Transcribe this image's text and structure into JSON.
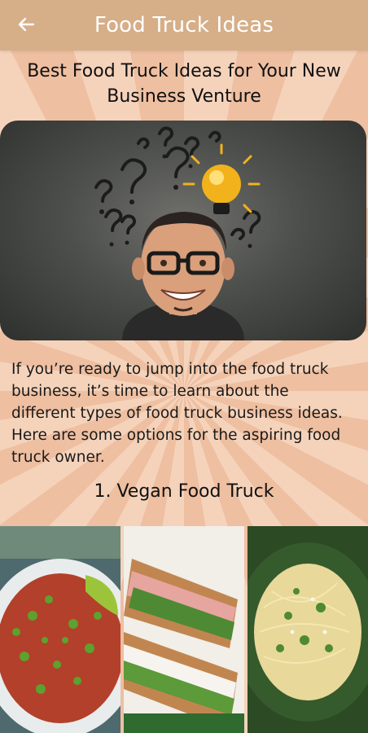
{
  "app_bar": {
    "title": "Food Truck Ideas",
    "back_icon": "arrow-left-icon",
    "color": "#d6ae87"
  },
  "article": {
    "headline": "Best Food Truck Ideas for Your New Business Venture",
    "hero_image": "man-thinking-with-question-marks-and-lightbulb",
    "intro": "If you’re ready to jump into the food truck business, it’s time to learn about the different types of food truck business ideas. Here are some options for the aspiring food truck owner.",
    "section_1_title": "1. Vegan Food Truck"
  },
  "photos": [
    {
      "name": "vegan-salad-bowl-photo"
    },
    {
      "name": "vegetable-sandwich-photo"
    },
    {
      "name": "pasta-with-herbs-photo"
    }
  ]
}
